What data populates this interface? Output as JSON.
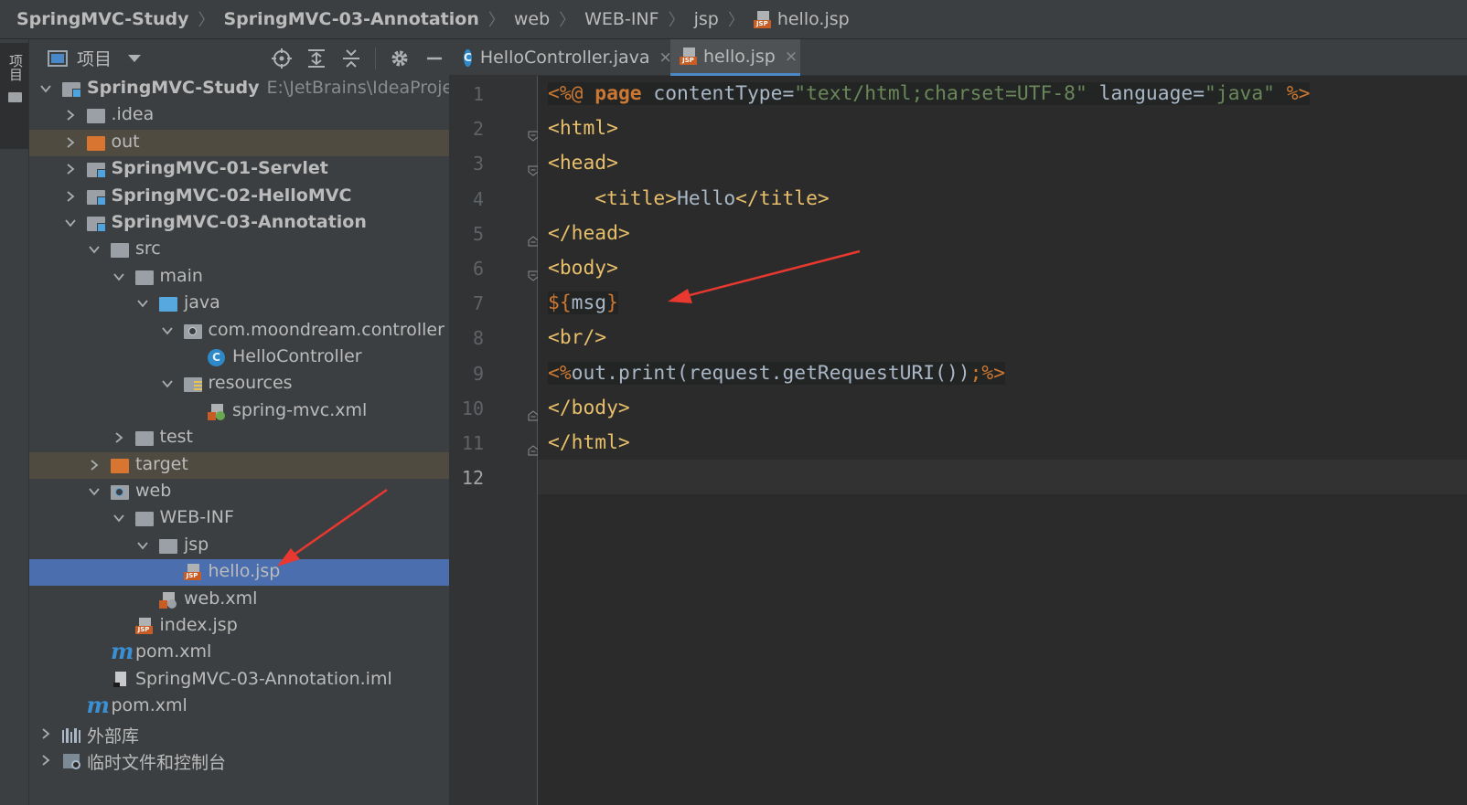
{
  "breadcrumb": {
    "items": [
      "SpringMVC-Study",
      "SpringMVC-03-Annotation",
      "web",
      "WEB-INF",
      "jsp",
      "hello.jsp"
    ],
    "separator": "〉",
    "file_icon": "jsp-file-icon"
  },
  "left_strip": {
    "label": "项目"
  },
  "project_panel": {
    "title": "项目",
    "tools": [
      "locate-icon",
      "expand-all-icon",
      "collapse-all-icon",
      "gear-icon",
      "minimize-icon"
    ]
  },
  "tree": [
    {
      "label": "SpringMVC-Study",
      "path": "E:\\JetBrains\\IdeaProjects\\Sp",
      "icon": "module-folder",
      "expanded": true
    },
    {
      "label": ".idea",
      "icon": "folder",
      "expanded": false
    },
    {
      "label": "out",
      "icon": "excluded-folder",
      "expanded": false
    },
    {
      "label": "SpringMVC-01-Servlet",
      "icon": "module-folder",
      "expanded": false
    },
    {
      "label": "SpringMVC-02-HelloMVC",
      "icon": "module-folder",
      "expanded": false
    },
    {
      "label": "SpringMVC-03-Annotation",
      "icon": "module-folder",
      "expanded": true
    },
    {
      "label": "src",
      "icon": "folder",
      "expanded": true
    },
    {
      "label": "main",
      "icon": "folder",
      "expanded": true
    },
    {
      "label": "java",
      "icon": "source-folder",
      "expanded": true
    },
    {
      "label": "com.moondream.controller",
      "icon": "package",
      "expanded": true
    },
    {
      "label": "HelloController",
      "icon": "class"
    },
    {
      "label": "resources",
      "icon": "resources-folder",
      "expanded": true
    },
    {
      "label": "spring-mvc.xml",
      "icon": "spring-xml"
    },
    {
      "label": "test",
      "icon": "folder",
      "expanded": false
    },
    {
      "label": "target",
      "icon": "excluded-folder",
      "expanded": false
    },
    {
      "label": "web",
      "icon": "web-folder",
      "expanded": true
    },
    {
      "label": "WEB-INF",
      "icon": "folder",
      "expanded": true
    },
    {
      "label": "jsp",
      "icon": "folder",
      "expanded": true
    },
    {
      "label": "hello.jsp",
      "icon": "jsp",
      "selected": true
    },
    {
      "label": "web.xml",
      "icon": "web-xml"
    },
    {
      "label": "index.jsp",
      "icon": "jsp"
    },
    {
      "label": "pom.xml",
      "icon": "maven"
    },
    {
      "label": "SpringMVC-03-Annotation.iml",
      "icon": "iml"
    },
    {
      "label": "pom.xml",
      "icon": "maven"
    },
    {
      "label": "外部库",
      "icon": "library",
      "expanded": false
    },
    {
      "label": "临时文件和控制台",
      "icon": "scratch",
      "expanded": false
    }
  ],
  "tabs": [
    {
      "label": "HelloController.java",
      "icon": "class",
      "active": false
    },
    {
      "label": "hello.jsp",
      "icon": "jsp",
      "active": true
    }
  ],
  "tab_close": "×",
  "editor": {
    "line_numbers": [
      "1",
      "2",
      "3",
      "4",
      "5",
      "6",
      "7",
      "8",
      "9",
      "10",
      "11",
      "12"
    ],
    "current_line": "12",
    "lines": [
      [
        [
          "<%@ ",
          "orange jspbg"
        ],
        [
          "page",
          "kw jspbg"
        ],
        [
          " contentType=",
          "jspbg"
        ],
        [
          "\"text/html;charset=UTF-8\"",
          "str jspbg"
        ],
        [
          " language=",
          "jspbg"
        ],
        [
          "\"java\"",
          "str jspbg"
        ],
        [
          " %>",
          "orange jspbg"
        ]
      ],
      [
        [
          "<html>",
          "tag"
        ]
      ],
      [
        [
          "<head>",
          "tag"
        ]
      ],
      [
        [
          "    ",
          ""
        ],
        [
          "<title>",
          "tag"
        ],
        [
          "Hello",
          ""
        ],
        [
          "</title>",
          "tag"
        ]
      ],
      [
        [
          "</head>",
          "tag"
        ]
      ],
      [
        [
          "<body>",
          "tag"
        ]
      ],
      [
        [
          "${",
          "orange jspbg"
        ],
        [
          "msg",
          "jspbg"
        ],
        [
          "}",
          "orange jspbg"
        ]
      ],
      [
        [
          "<br/>",
          "tag"
        ]
      ],
      [
        [
          "<%",
          "orange jspbg"
        ],
        [
          "out.print(request.getRequestURI())",
          "jspbg"
        ],
        [
          ";%>",
          "orange jspbg"
        ]
      ],
      [
        [
          "</body>",
          "tag"
        ]
      ],
      [
        [
          "</html>",
          "tag"
        ]
      ],
      []
    ]
  },
  "colors": {
    "accent": "#4a88c7",
    "selection": "#4b6eaf",
    "excluded_row": "#4f4b41",
    "annotation_arrow": "#e8382f"
  }
}
